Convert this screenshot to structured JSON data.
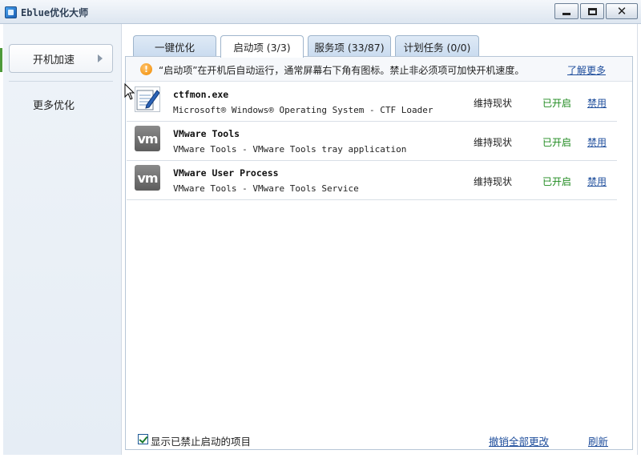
{
  "window": {
    "title": "Eblue优化大师",
    "minimize_label": "",
    "maximize_label": "",
    "close_label": "✕"
  },
  "sidebar": {
    "items": [
      {
        "label": "开机加速",
        "selected": true
      },
      {
        "label": "更多优化",
        "selected": false
      }
    ]
  },
  "tabs": [
    {
      "label": "一键优化",
      "active": false
    },
    {
      "label": "启动项 (3/3)",
      "active": true
    },
    {
      "label": "服务项 (33/87)",
      "active": false
    },
    {
      "label": "计划任务 (0/0)",
      "active": false
    }
  ],
  "notice": {
    "icon": "!",
    "text": "“启动项”在开机后自动运行，通常屏幕右下角有图标。禁止非必须项可加快开机速度。",
    "link": "了解更多"
  },
  "startup_items": [
    {
      "icon": "notepad-icon",
      "name": "ctfmon.exe",
      "description": "Microsoft® Windows® Operating System - CTF Loader",
      "recommendation": "维持现状",
      "status": "已开启",
      "action": "禁用"
    },
    {
      "icon": "vmware-icon",
      "icon_text": "vm",
      "name": "VMware Tools",
      "description": "VMware Tools - VMware Tools tray application",
      "recommendation": "维持现状",
      "status": "已开启",
      "action": "禁用"
    },
    {
      "icon": "vmware-icon",
      "icon_text": "vm",
      "name": "VMware User Process",
      "description": "VMware Tools - VMware Tools Service",
      "recommendation": "维持现状",
      "status": "已开启",
      "action": "禁用"
    }
  ],
  "footer": {
    "show_disabled_label": "显示已禁止启动的项目",
    "show_disabled_checked": true,
    "undo_all_label": "撤销全部更改",
    "refresh_label": "刷新"
  },
  "colors": {
    "status_enabled": "#1e8a1e",
    "link": "#1f4e9c",
    "warning": "#f08a00"
  }
}
